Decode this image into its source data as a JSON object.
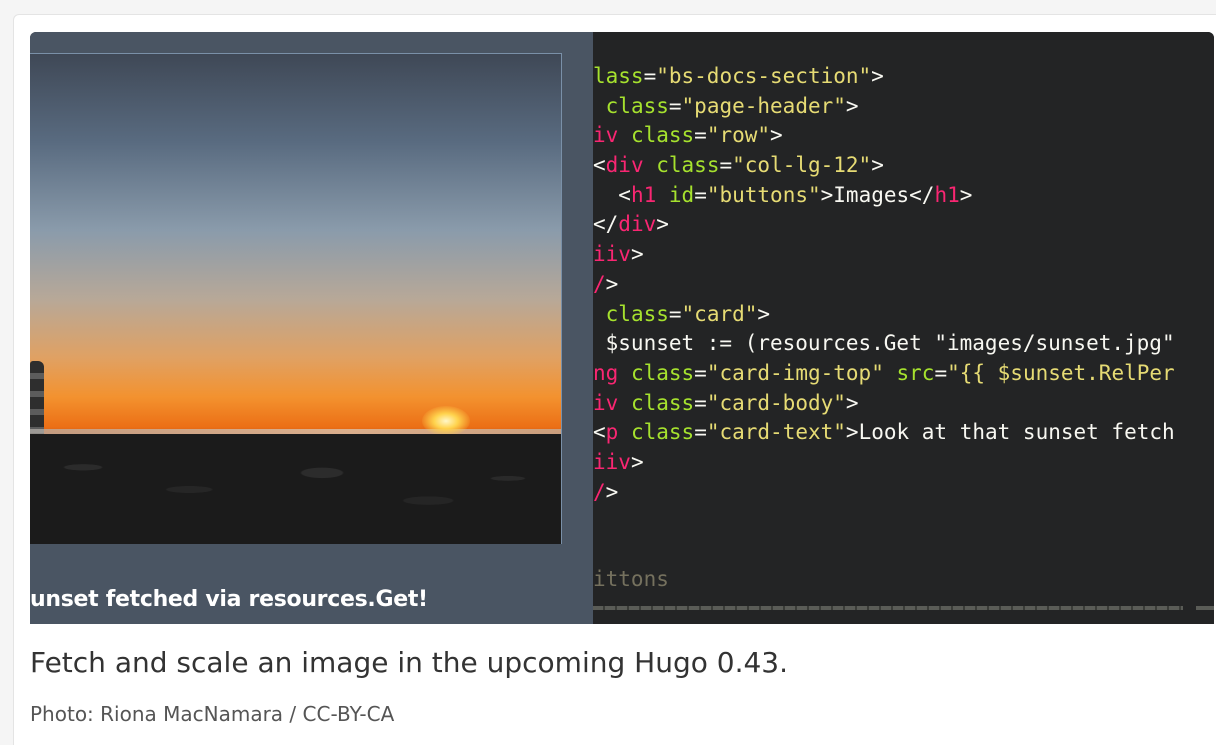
{
  "figure": {
    "preview_caption": "unset fetched via resources.Get!",
    "code_lines": [
      [
        {
          "c": "attr",
          "t": "lass"
        },
        {
          "c": "plain",
          "t": "="
        },
        {
          "c": "str",
          "t": "\"bs-docs-section\""
        },
        {
          "c": "plain",
          "t": ">"
        }
      ],
      [
        {
          "c": "plain",
          "t": " "
        },
        {
          "c": "attr",
          "t": "class"
        },
        {
          "c": "plain",
          "t": "="
        },
        {
          "c": "str",
          "t": "\"page-header\""
        },
        {
          "c": "plain",
          "t": ">"
        }
      ],
      [
        {
          "c": "tag",
          "t": "iv"
        },
        {
          "c": "plain",
          "t": " "
        },
        {
          "c": "attr",
          "t": "class"
        },
        {
          "c": "plain",
          "t": "="
        },
        {
          "c": "str",
          "t": "\"row\""
        },
        {
          "c": "plain",
          "t": ">"
        }
      ],
      [
        {
          "c": "plain",
          "t": "<"
        },
        {
          "c": "tag",
          "t": "div"
        },
        {
          "c": "plain",
          "t": " "
        },
        {
          "c": "attr",
          "t": "class"
        },
        {
          "c": "plain",
          "t": "="
        },
        {
          "c": "str",
          "t": "\"col-lg-12\""
        },
        {
          "c": "plain",
          "t": ">"
        }
      ],
      [
        {
          "c": "plain",
          "t": "  <"
        },
        {
          "c": "tag",
          "t": "h1"
        },
        {
          "c": "plain",
          "t": " "
        },
        {
          "c": "attr",
          "t": "id"
        },
        {
          "c": "plain",
          "t": "="
        },
        {
          "c": "str",
          "t": "\"buttons\""
        },
        {
          "c": "plain",
          "t": ">Images</"
        },
        {
          "c": "tag",
          "t": "h1"
        },
        {
          "c": "plain",
          "t": ">"
        }
      ],
      [
        {
          "c": "plain",
          "t": "</"
        },
        {
          "c": "tag",
          "t": "div"
        },
        {
          "c": "plain",
          "t": ">"
        }
      ],
      [
        {
          "c": "tag",
          "t": "iiv"
        },
        {
          "c": "plain",
          "t": ">"
        }
      ],
      [
        {
          "c": "tag",
          "t": "/"
        },
        {
          "c": "plain",
          "t": ">"
        }
      ],
      [
        {
          "c": "plain",
          "t": " "
        },
        {
          "c": "attr",
          "t": "class"
        },
        {
          "c": "plain",
          "t": "="
        },
        {
          "c": "str",
          "t": "\"card\""
        },
        {
          "c": "plain",
          "t": ">"
        }
      ],
      [
        {
          "c": "plain",
          "t": " $sunset := (resources.Get \"images/sunset.jpg\""
        }
      ],
      [
        {
          "c": "tag",
          "t": "ng"
        },
        {
          "c": "plain",
          "t": " "
        },
        {
          "c": "attr",
          "t": "class"
        },
        {
          "c": "plain",
          "t": "="
        },
        {
          "c": "str",
          "t": "\"card-img-top\""
        },
        {
          "c": "plain",
          "t": " "
        },
        {
          "c": "attr",
          "t": "src"
        },
        {
          "c": "plain",
          "t": "="
        },
        {
          "c": "str",
          "t": "\"{{ $sunset.RelPer"
        }
      ],
      [
        {
          "c": "tag",
          "t": "iv"
        },
        {
          "c": "plain",
          "t": " "
        },
        {
          "c": "attr",
          "t": "class"
        },
        {
          "c": "plain",
          "t": "="
        },
        {
          "c": "str",
          "t": "\"card-body\""
        },
        {
          "c": "plain",
          "t": ">"
        }
      ],
      [
        {
          "c": "plain",
          "t": "<"
        },
        {
          "c": "tag",
          "t": "p"
        },
        {
          "c": "plain",
          "t": " "
        },
        {
          "c": "attr",
          "t": "class"
        },
        {
          "c": "plain",
          "t": "="
        },
        {
          "c": "str",
          "t": "\"card-text\""
        },
        {
          "c": "plain",
          "t": ">Look at that sunset fetch"
        }
      ],
      [
        {
          "c": "tag",
          "t": "iiv"
        },
        {
          "c": "plain",
          "t": ">"
        }
      ],
      [
        {
          "c": "tag",
          "t": "/"
        },
        {
          "c": "plain",
          "t": ">"
        }
      ]
    ],
    "comment_text": "ittons"
  },
  "caption": "Fetch and scale an image in the upcoming Hugo 0.43.",
  "credit": "Photo: Riona MacNamara / CC-BY-CA",
  "colors": {
    "tag": "#f92672",
    "attr": "#a6e22e",
    "string": "#e6db74",
    "plain": "#f8f8f2",
    "comment": "#75715e",
    "editor_bg": "#232425"
  }
}
